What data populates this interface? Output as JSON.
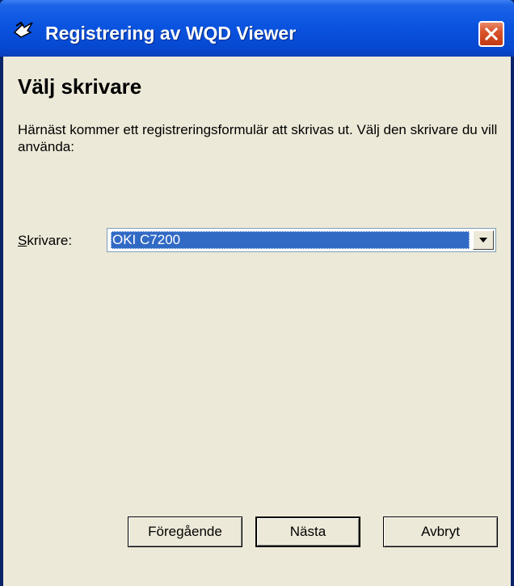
{
  "window": {
    "title": "Registrering av WQD Viewer",
    "close_icon": "close-icon",
    "app_icon": "wqd-app-icon"
  },
  "page": {
    "heading": "Välj skrivare",
    "description": "Härnäst kommer ett registreringsformulär att skrivas ut. Välj den skrivare du vill använda:"
  },
  "printer": {
    "label_accel": "S",
    "label_rest": "krivare:",
    "selected": "OKI C7200",
    "dropdown_icon": "chevron-down-icon"
  },
  "buttons": {
    "previous": "Föregående",
    "next": "Nästa",
    "cancel": "Avbryt"
  },
  "colors": {
    "titlebar": "#0a54e0",
    "client_bg": "#ece9d8",
    "selection": "#316ac5",
    "close": "#d9532c"
  }
}
